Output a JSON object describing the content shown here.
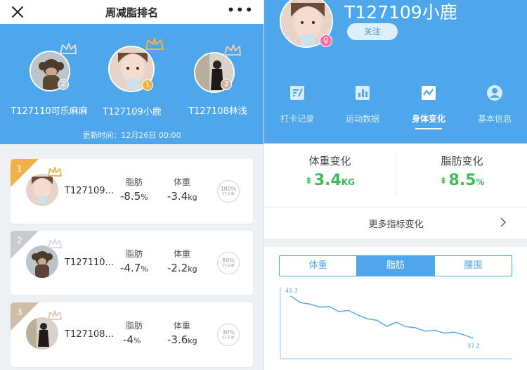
{
  "left": {
    "nav": {
      "title": "周减脂排名"
    },
    "podium": [
      {
        "name": "T127110可乐麻麻",
        "rank": "2"
      },
      {
        "name": "T127109小鹿",
        "rank": "1"
      },
      {
        "name": "T127108林浅",
        "rank": "3"
      }
    ],
    "updated": "更新时间：12月26日 00:00",
    "list": [
      {
        "rank": "1",
        "name": "T127109...",
        "fat_label": "脂肪",
        "fat": "-8.5",
        "fat_unit": "%",
        "weight_label": "体重",
        "weight": "-3.4",
        "weight_unit": "kg",
        "checkin": "100%",
        "checkin_label": "打卡率"
      },
      {
        "rank": "2",
        "name": "T127110...",
        "fat_label": "脂肪",
        "fat": "-4.7",
        "fat_unit": "%",
        "weight_label": "体重",
        "weight": "-2.2",
        "weight_unit": "kg",
        "checkin": "89%",
        "checkin_label": "打卡率"
      },
      {
        "rank": "3",
        "name": "T127108...",
        "fat_label": "脂肪",
        "fat": "-4",
        "fat_unit": "%",
        "weight_label": "体重",
        "weight": "-3.6",
        "weight_unit": "kg",
        "checkin": "30%",
        "checkin_label": "打卡率"
      }
    ],
    "colors": {
      "header": "#4ea7ea",
      "gold": "#f0b04a",
      "silver": "#c8ccd1",
      "bronze": "#d1bca8"
    }
  },
  "right": {
    "profile": {
      "name": "T127109小鹿",
      "follow": "关注",
      "gender_icon": "female-icon"
    },
    "tabs": [
      {
        "label": "打卡记录",
        "icon": "checkin-record-icon"
      },
      {
        "label": "运动数据",
        "icon": "exercise-data-icon"
      },
      {
        "label": "身体变化",
        "icon": "body-change-icon"
      },
      {
        "label": "基本信息",
        "icon": "basic-info-icon"
      }
    ],
    "active_tab": "身体变化",
    "metrics": [
      {
        "title": "体重变化",
        "value": "3.4",
        "unit": "KG"
      },
      {
        "title": "脂肪变化",
        "value": "8.5",
        "unit": "%"
      }
    ],
    "more": "更多指标变化",
    "segments": [
      "体重",
      "脂肪",
      "腰围"
    ],
    "active_segment": "脂肪",
    "accent": "#4ea7ea",
    "decrease_color": "#3dbf55"
  },
  "chart_data": {
    "type": "line",
    "title": "",
    "xlabel": "",
    "ylabel": "",
    "series": [
      {
        "values": [
          45.7,
          44.4,
          44.1,
          43.5,
          43.6,
          42.6,
          42.8,
          41.9,
          41.1,
          40.8,
          39.6,
          40.4,
          39.5,
          39.3,
          38.6,
          38.8,
          38.2,
          38.4,
          37.9,
          37.2
        ]
      }
    ],
    "annotations": [
      {
        "point": "first",
        "label": "45.7"
      },
      {
        "point": "last",
        "label": "37.2"
      }
    ],
    "ylim": [
      33,
      47
    ],
    "grid": false
  }
}
